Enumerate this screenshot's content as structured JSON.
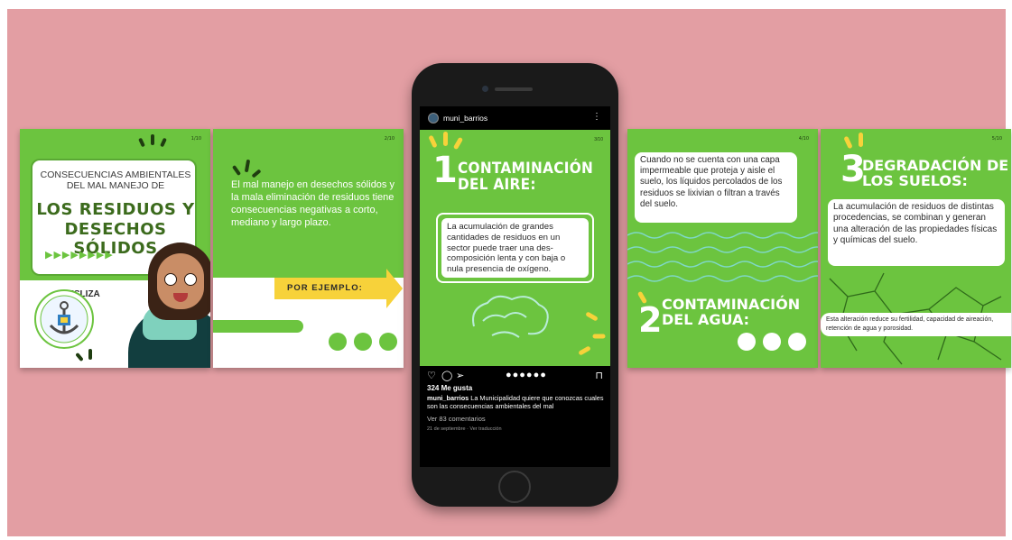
{
  "card1": {
    "page": "1/10",
    "heading": "CONSECUENCIAS AMBIENTALES DEL MAL MANEJO DE",
    "title_line1": "LOS RESIDUOS Y",
    "title_line2": "DESECHOS SÓLIDOS",
    "arrows": "▶▶▶▶▶▶▶▶",
    "cta": "DESLIZA",
    "logo_caption": "La Municipalidad"
  },
  "card2": {
    "page": "2/10",
    "body": "El mal manejo en desechos sólidos y la mala eliminación de residuos tiene consecuencias negativas a corto, mediano y largo plazo.",
    "banner": "POR EJEMPLO:"
  },
  "phone": {
    "username": "muni_barrios",
    "post": {
      "page": "3/10",
      "number": "1",
      "title": "CONTAMINACIÓN DEL AIRE:",
      "body": "La acumulación de grandes cantidades de residuos en un sector puede traer una des-composición lenta y con baja o nula presencia de oxígeno."
    },
    "likes": "324 Me gusta",
    "caption_user": "muni_barrios",
    "caption_text": "La Municipalidad quiere que conozcas cuales son las consecuencias ambientales del mal",
    "comments": "Ver 83 comentarios",
    "date": "21 de septiembre · Ver traducción",
    "icons": {
      "like": "heart-icon",
      "comment": "comment-icon",
      "share": "share-icon",
      "save": "bookmark-icon",
      "more": "more-icon"
    }
  },
  "card4": {
    "page": "4/10",
    "body": "Cuando no se cuenta con una capa impermeable que proteja y aisle el suelo, los líquidos percolados de los residuos se lixivian o filtran a través del suelo.",
    "number": "2",
    "title": "CONTAMINACIÓN DEL AGUA:"
  },
  "card5": {
    "page": "5/10",
    "number": "3",
    "title": "DEGRADACIÓN DE LOS SUELOS:",
    "body": "La acumulación de residuos de distintas procedencias, se combinan y generan una alteración de las propiedades físicas y químicas del suelo.",
    "note": "Esta alteración reduce su fertilidad, capacidad de aireación, retención de agua y porosidad."
  },
  "colors": {
    "background": "#e39ea3",
    "green": "#6cc43f",
    "yellow": "#f7d23a",
    "dark_green": "#1f3d10"
  }
}
